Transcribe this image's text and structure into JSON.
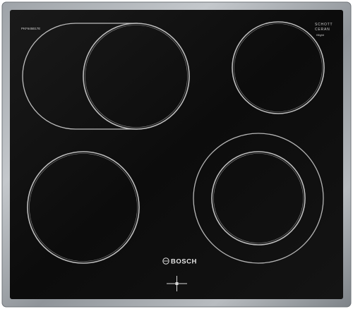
{
  "product": {
    "model_code": "PKF645B17E",
    "logo_top": "SCHOTT",
    "logo_bottom": "CERAN",
    "logo_sub": "Hilightt",
    "brand": "BOSCH"
  },
  "icons": {
    "brand_logo": "bosch-armature-logo-icon",
    "control": "touch-control-cross-icon"
  },
  "colors": {
    "glass": "#0f0f0f",
    "frame": "#a9aeb3",
    "zone_ring": "#bdbdbd"
  }
}
